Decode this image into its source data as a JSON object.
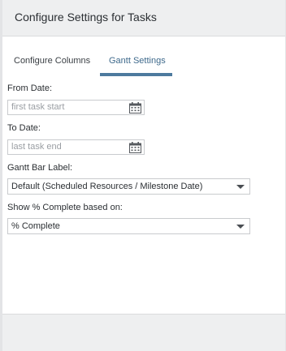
{
  "dialog": {
    "title": "Configure Settings for Tasks"
  },
  "tabs": [
    {
      "label": "Configure Columns",
      "active": false
    },
    {
      "label": "Gantt Settings",
      "active": true
    }
  ],
  "form": {
    "from_date": {
      "label": "From Date:",
      "placeholder": "first task start",
      "icon": "calendar-icon"
    },
    "to_date": {
      "label": "To Date:",
      "placeholder": "last task end",
      "icon": "calendar-icon"
    },
    "gantt_bar_label": {
      "label": "Gantt Bar Label:",
      "selected": "Default (Scheduled Resources / Milestone Date)"
    },
    "percent_complete_basis": {
      "label": "Show % Complete based on:",
      "selected": "% Complete"
    }
  },
  "colors": {
    "accent": "#4d7a9e",
    "active_tab_text": "#3f6a8c",
    "header_bg": "#eeeff0"
  }
}
